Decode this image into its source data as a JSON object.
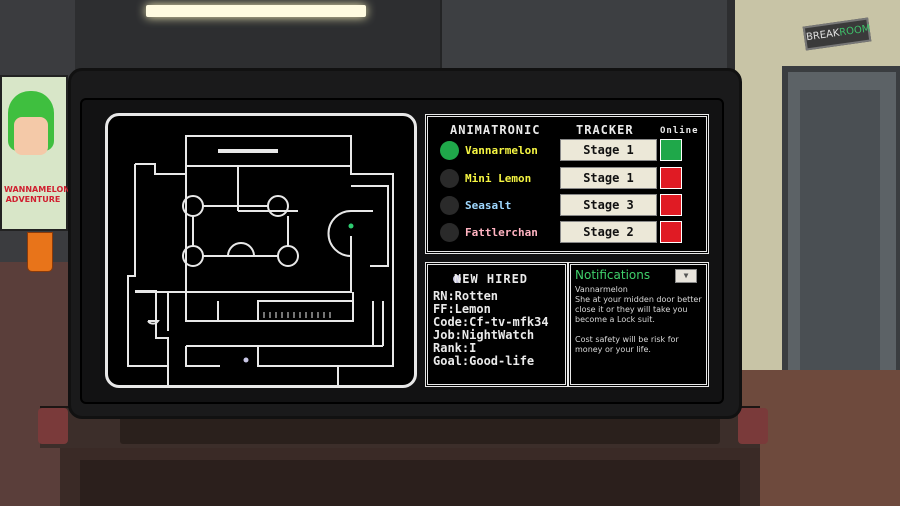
{
  "scene": {
    "poster_title": "WANNAMELON ADVENTURE",
    "breakroom_sign": "BREAK",
    "breakroom_sign_highlight": "ROOM"
  },
  "tracker": {
    "header_left": "ANIMATRONIC",
    "header_right": "TRACKER",
    "header_online": "Online",
    "rows": [
      {
        "name": "Vannarmelon",
        "stage": "Stage 1",
        "name_color": "#f5f542",
        "online_color": "#1fa84a",
        "active": true
      },
      {
        "name": "Mini Lemon",
        "stage": "Stage 1",
        "name_color": "#f5f542",
        "online_color": "#e01b24",
        "active": false
      },
      {
        "name": "Seasalt",
        "stage": "Stage 3",
        "name_color": "#9fd8ff",
        "online_color": "#e01b24",
        "active": false
      },
      {
        "name": "Fattlerchan",
        "stage": "Stage 2",
        "name_color": "#ffb3c1",
        "online_color": "#e01b24",
        "active": false
      }
    ]
  },
  "hired": {
    "title": "NEW HIRED",
    "lines": [
      "RN:Rotten",
      "FF:Lemon",
      "Code:Cf-tv-mfk34",
      "Job:NightWatch",
      "Rank:I",
      "Goal:Good-life"
    ]
  },
  "notifications": {
    "title": "Notifications",
    "body": "Vannarmelon\nShe at your midden door better close it or they will take you become a Lock suit.\n\nCost safety will be risk for money or your life."
  },
  "colors": {
    "accent_green": "#3fcf6a",
    "alert_red": "#e01b24",
    "online_green": "#1fa84a"
  }
}
